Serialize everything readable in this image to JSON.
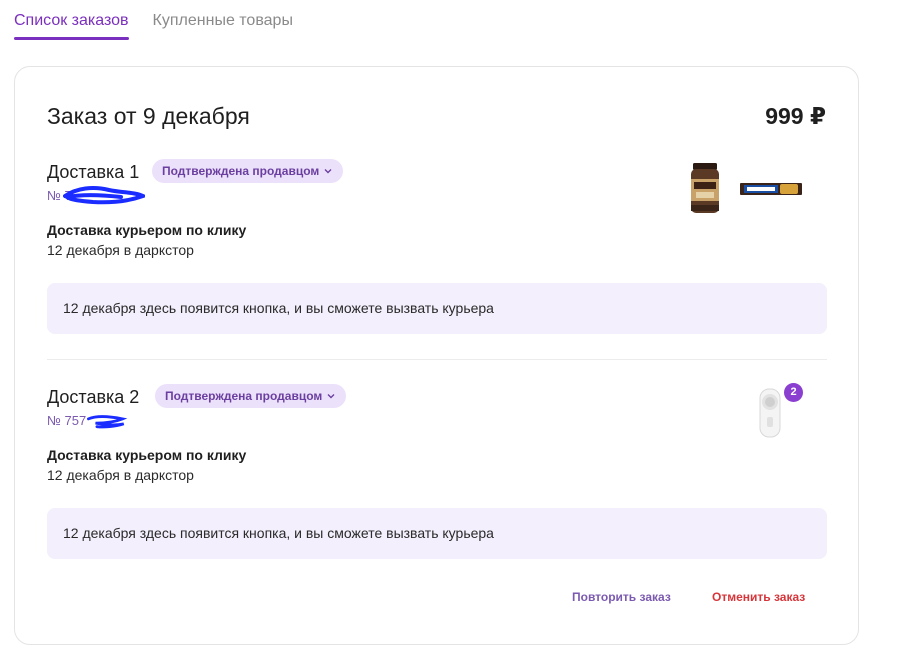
{
  "tabs": [
    {
      "label": "Список заказов",
      "active": true
    },
    {
      "label": "Купленные товары",
      "active": false
    }
  ],
  "order": {
    "title": "Заказ от 9 декабря",
    "total": "999 ₽",
    "deliveries": [
      {
        "title": "Доставка 1",
        "status": "Подтверждена продавцом",
        "number_prefix": "№ 7",
        "method": "Доставка курьером по клику",
        "date": "12 декабря в даркстор",
        "notice": "12 декабря здесь появится кнопка, и вы сможете вызвать курьера",
        "items": [
          "coffee-jar",
          "snickers-bar"
        ]
      },
      {
        "title": "Доставка 2",
        "status": "Подтверждена продавцом",
        "number_prefix": "№ 757",
        "method": "Доставка курьером по клику",
        "date": "12 декабря в даркстор",
        "notice": "12 декабря здесь появится кнопка, и вы сможете вызвать курьера",
        "items": [
          "lint-remover"
        ],
        "item_quantity": "2"
      }
    ],
    "actions": {
      "repeat": "Повторить заказ",
      "cancel": "Отменить заказ"
    }
  },
  "colors": {
    "accent": "#7b2fbe",
    "badge_bg": "#ece1fa",
    "notice_bg": "#f3effc",
    "cancel": "#d6353a",
    "redaction": "#1a2cff"
  }
}
